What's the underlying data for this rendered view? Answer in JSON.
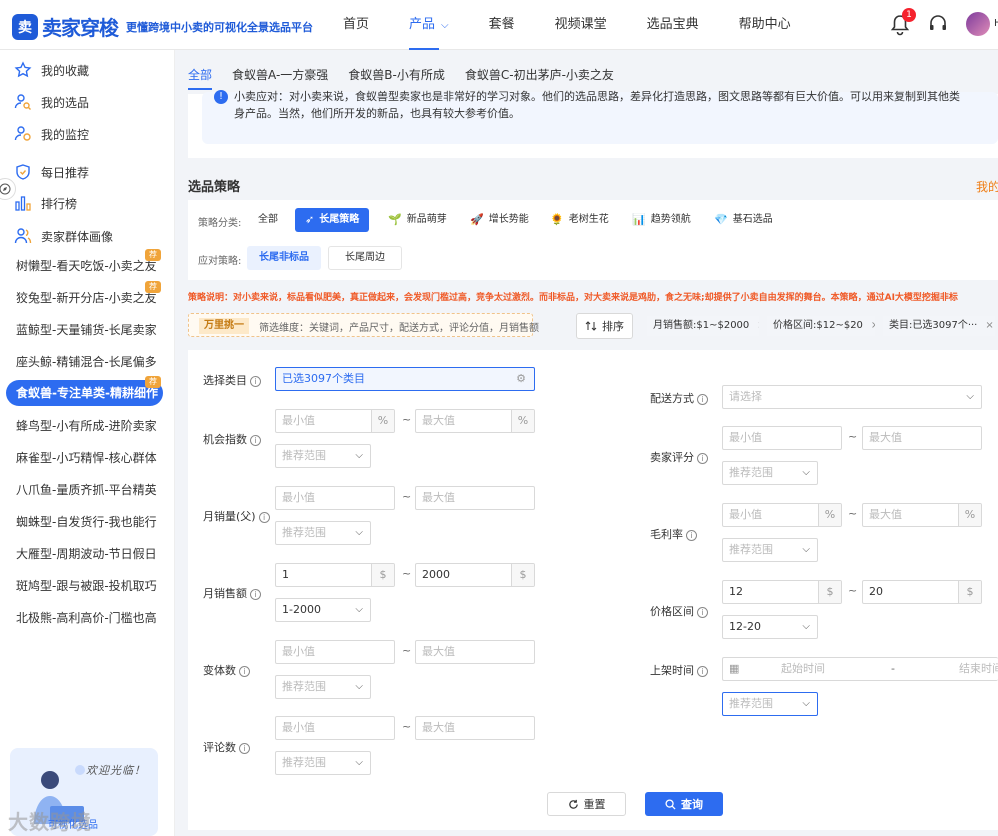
{
  "brand": {
    "logo_mark": "卖",
    "name": "卖家穿梭",
    "slogan": "更懂跨境中小卖的可视化全景选品平台"
  },
  "nav": [
    {
      "label": "首页"
    },
    {
      "label": "产品",
      "chevron": "⌵"
    },
    {
      "label": "套餐"
    },
    {
      "label": "视频课堂"
    },
    {
      "label": "选品宝典"
    },
    {
      "label": "帮助中心"
    }
  ],
  "header": {
    "notif_count": "1",
    "user_initial": "H"
  },
  "sidebar": {
    "items": [
      {
        "label": "我的收藏",
        "icon": "star-icon"
      },
      {
        "label": "我的选品",
        "icon": "user-search-icon"
      },
      {
        "label": "我的监控",
        "icon": "monitor-icon"
      },
      {
        "label": "每日推荐",
        "icon": "shield-icon"
      },
      {
        "label": "排行榜",
        "icon": "bar-chart-icon"
      },
      {
        "label": "卖家群体画像",
        "icon": "users-icon"
      }
    ],
    "groups": [
      "树懒型-看天吃饭-小卖之友",
      "狡兔型-新开分店-小卖之友",
      "蓝鲸型-天量铺货-长尾卖家",
      "座头鲸-精铺混合-长尾偏多",
      "食蚁兽-专注单类-精耕细作",
      "蜂鸟型-小有所成-进阶卖家",
      "麻雀型-小巧精悍-核心群体",
      "八爪鱼-量质齐抓-平台精英",
      "蜘蛛型-自发货行-我也能行",
      "大雁型-周期波动-节日假日",
      "斑鸠型-跟与被跟-投机取巧",
      "北极熊-高利高价-门槛也高"
    ],
    "tag_label": "荐",
    "welcome_text": "欢迎光临！",
    "welcome_link": "可视化选品"
  },
  "watermark": "大数跨境",
  "tabs": [
    "全部",
    "食蚁兽A-一方豪强",
    "食蚁兽B-小有所成",
    "食蚁兽C-初出茅庐-小卖之友"
  ],
  "info": {
    "line1": "小卖应对：对小卖来说，食蚁兽型卖家也是非常好的学习对象。他们的选品思路，差异化打造思路，图文思路等都有巨大价值。可以用来复制到其他类",
    "line2": "身产品。当然，他们所开发的新品，也具有较大参考价值。"
  },
  "strategy": {
    "title": "选品策略",
    "right_link": "我的",
    "class_label": "策略分类:",
    "classes": [
      {
        "label": "全部",
        "icon": ""
      },
      {
        "label": "长尾策略",
        "icon": "➶"
      },
      {
        "label": "新品萌芽",
        "icon": "🌱"
      },
      {
        "label": "增长势能",
        "icon": "🚀"
      },
      {
        "label": "老树生花",
        "icon": "🌻"
      },
      {
        "label": "趋势领航",
        "icon": "📊"
      },
      {
        "label": "基石选品",
        "icon": "💎"
      }
    ],
    "response_label": "应对策略:",
    "responses": [
      "长尾非标品",
      "长尾周边"
    ],
    "description": "策略说明：对小卖来说，标品看似肥美，真正做起来，会发现门槛过高，竞争太过激烈。而非标品，对大卖来说是鸡肋，食之无味;却提供了小卖自由发挥的舞台。本策略，通过AI大模型挖掘非标"
  },
  "filter_bar": {
    "tag": "万里挑一",
    "text": "筛选维度：关键词，产品尺寸，配送方式，评论分值，月销售额"
  },
  "sort_label": "排序",
  "active_filters": [
    "月销售额:$1~$2000",
    "价格区间:$12~$20",
    "类目:已选3097个···"
  ],
  "form": {
    "category": {
      "label": "选择类目",
      "value": "已选3097个类目"
    },
    "min_placeholder": "最小值",
    "max_placeholder": "最大值",
    "range_placeholder": "推荐范围",
    "select_placeholder": "请选择",
    "opportunity": {
      "label": "机会指数",
      "unit": "%"
    },
    "monthly_sales": {
      "label": "月销量(父)"
    },
    "monthly_revenue": {
      "label": "月销售额",
      "min": "1",
      "max": "2000",
      "unit": "$",
      "range": "1-2000"
    },
    "variants": {
      "label": "变体数"
    },
    "reviews": {
      "label": "评论数"
    },
    "shipping": {
      "label": "配送方式"
    },
    "seller_rating": {
      "label": "卖家评分"
    },
    "gross_margin": {
      "label": "毛利率",
      "unit": "%"
    },
    "price": {
      "label": "价格区间",
      "min": "12",
      "max": "20",
      "unit": "$",
      "range": "12-20"
    },
    "listing_time": {
      "label": "上架时间",
      "start": "起始时间",
      "sep": "-",
      "end": "结束时间"
    },
    "tilde": "~",
    "q_mark": "i"
  },
  "buttons": {
    "reset": "重置",
    "query": "查询"
  }
}
